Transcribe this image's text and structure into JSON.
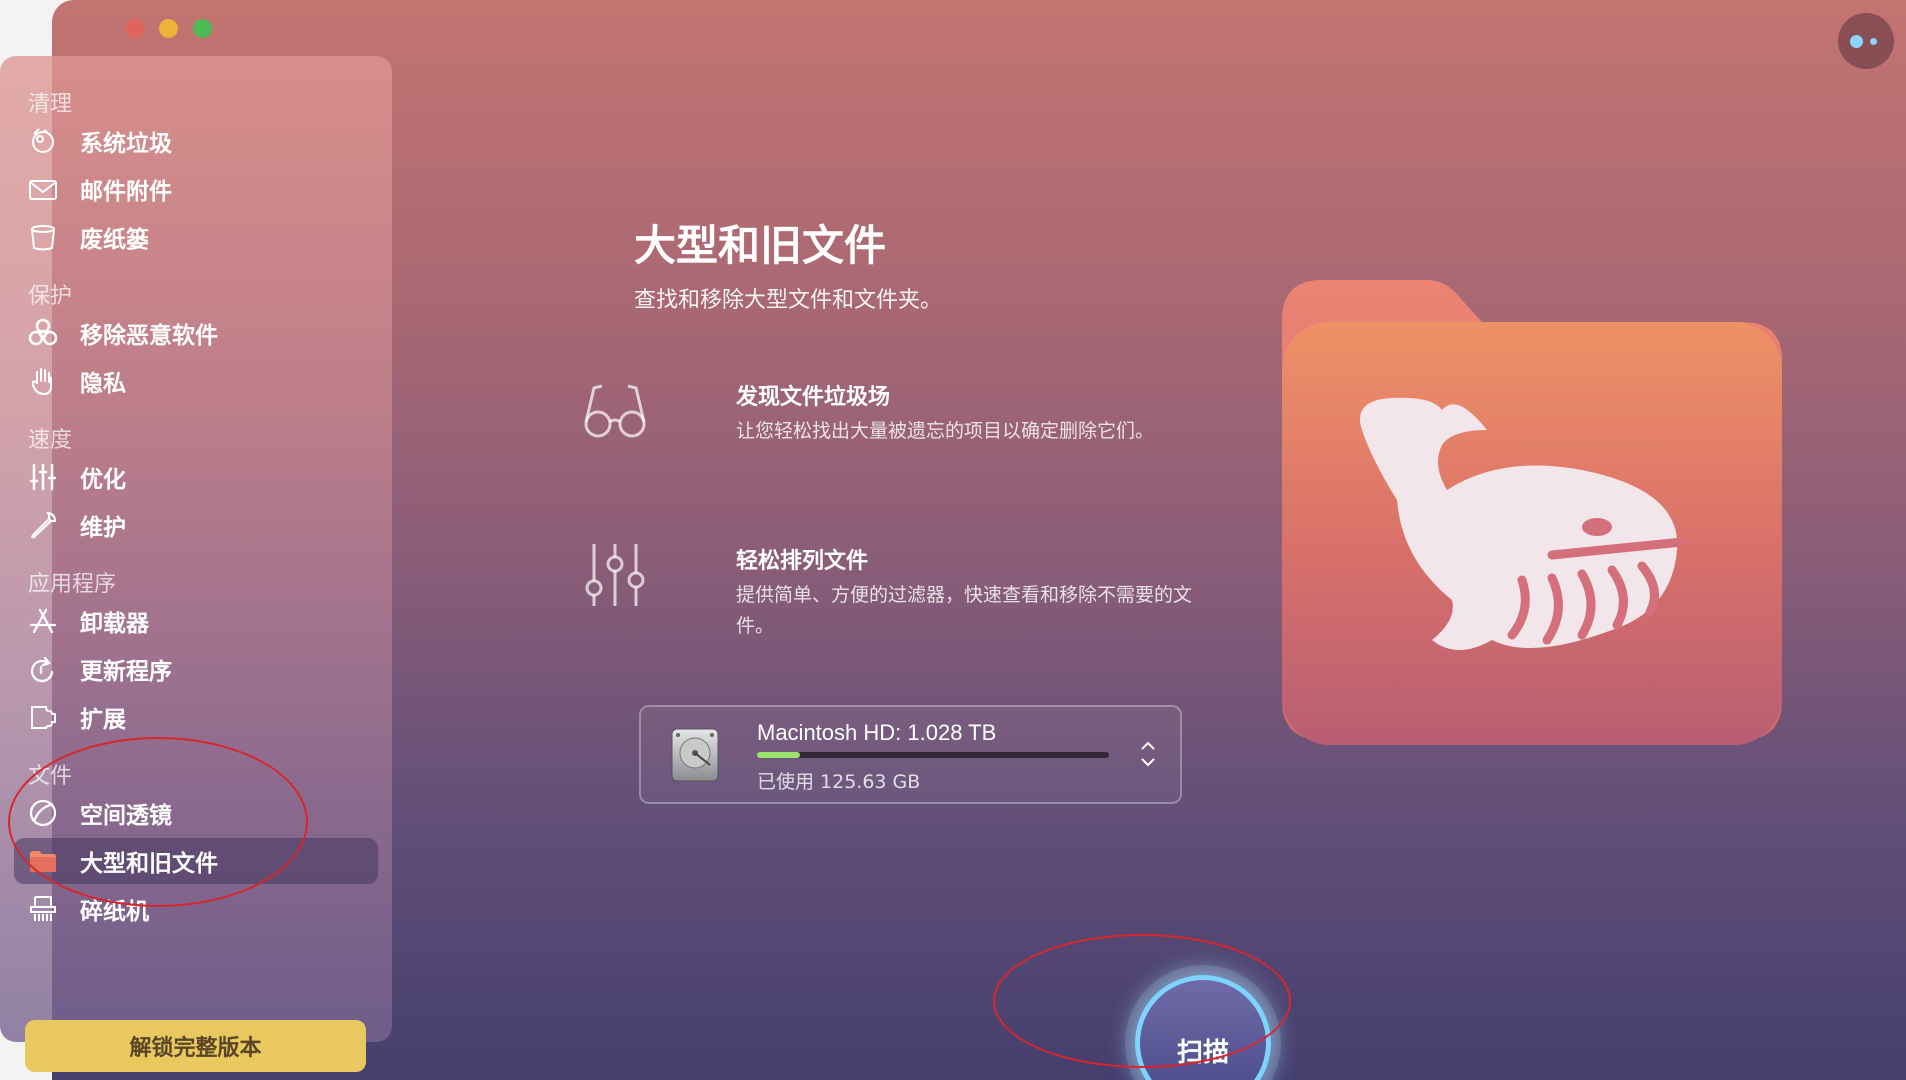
{
  "window": {
    "traffic_lights": [
      "close",
      "minimize",
      "zoom"
    ]
  },
  "sidebar": {
    "sections": {
      "clean": "清理",
      "protect": "保护",
      "speed": "速度",
      "apps": "应用程序",
      "files": "文件"
    },
    "items": [
      {
        "label": "系统垃圾",
        "icon": "system-junk-icon"
      },
      {
        "label": "邮件附件",
        "icon": "mail-icon"
      },
      {
        "label": "废纸篓",
        "icon": "trash-icon"
      },
      {
        "label": "移除恶意软件",
        "icon": "biohazard-icon"
      },
      {
        "label": "隐私",
        "icon": "hand-icon"
      },
      {
        "label": "优化",
        "icon": "sliders-icon"
      },
      {
        "label": "维护",
        "icon": "wrench-icon"
      },
      {
        "label": "卸载器",
        "icon": "app-store-icon"
      },
      {
        "label": "更新程序",
        "icon": "update-icon"
      },
      {
        "label": "扩展",
        "icon": "extension-icon"
      },
      {
        "label": "空间透镜",
        "icon": "space-lens-icon"
      },
      {
        "label": "大型和旧文件",
        "icon": "folder-icon",
        "active": true
      },
      {
        "label": "碎纸机",
        "icon": "shredder-icon"
      }
    ],
    "unlock_label": "解锁完整版本"
  },
  "main": {
    "title": "大型和旧文件",
    "subtitle": "查找和移除大型文件和文件夹。",
    "features": [
      {
        "title": "发现文件垃圾场",
        "desc": "让您轻松找出大量被遗忘的项目以确定删除它们。",
        "icon": "glasses-icon"
      },
      {
        "title": "轻松排列文件",
        "desc": "提供简单、方便的过滤器，快速查看和移除不需要的文件。",
        "icon": "filter-sliders-icon"
      }
    ],
    "disk": {
      "name": "Macintosh HD: 1.028 TB",
      "used": "已使用 125.63 GB",
      "used_fraction": 0.122
    },
    "scan_label": "扫描"
  },
  "colors": {
    "accent_yellow": "#e9c85f",
    "usage_green": "#9be36c",
    "scan_ring": "#7fd4ff",
    "annotation_red": "#d8262c"
  }
}
